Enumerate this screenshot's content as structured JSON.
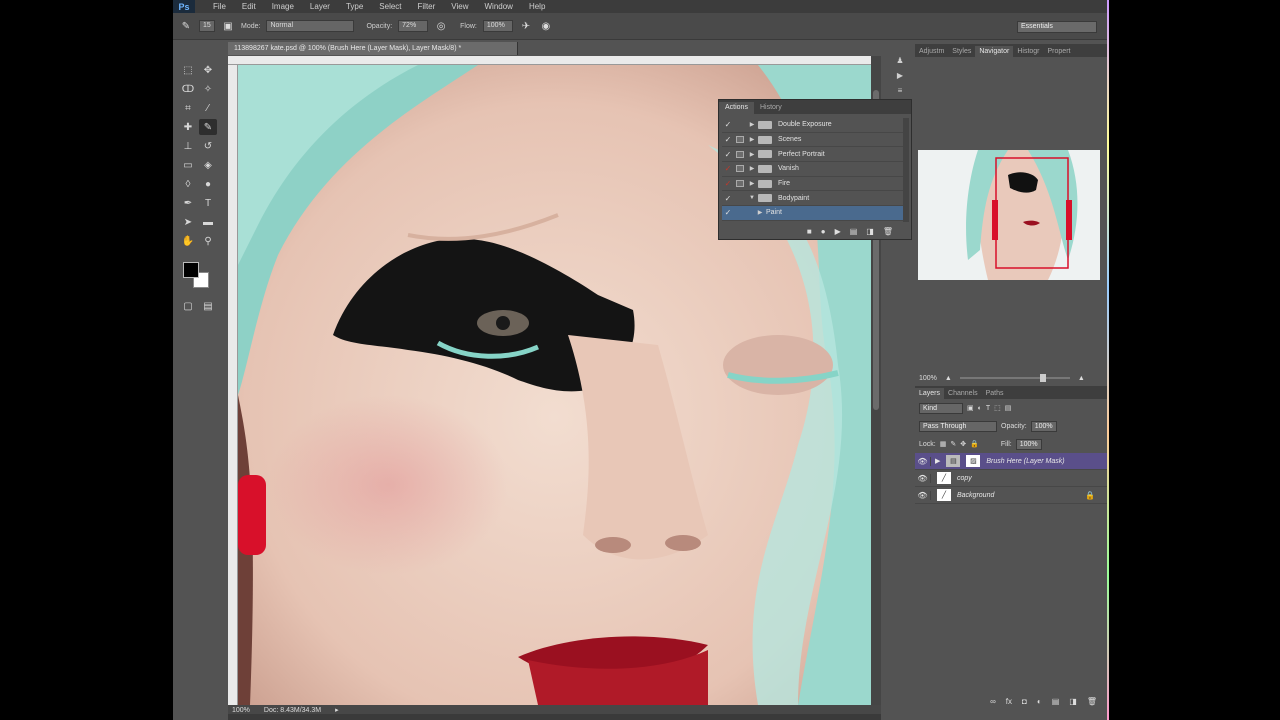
{
  "app": {
    "logo": "Ps"
  },
  "menu": [
    "File",
    "Edit",
    "Image",
    "Layer",
    "Type",
    "Select",
    "Filter",
    "View",
    "Window",
    "Help"
  ],
  "options": {
    "brush_size": "15",
    "mode_label": "Mode:",
    "mode_value": "Normal",
    "opacity_label": "Opacity:",
    "opacity_value": "72%",
    "flow_label": "Flow:",
    "flow_value": "100%",
    "workspace": "Essentials"
  },
  "document": {
    "tab_title": "113898267 kate.psd @ 100% (Brush Here (Layer Mask), Layer Mask/8) *",
    "zoom": "100%",
    "doc_size": "Doc: 8.43M/34.3M"
  },
  "actions_panel": {
    "tabs": [
      "Actions",
      "History"
    ],
    "rows": [
      {
        "name": "Double Exposure",
        "checked": true,
        "dialog": false,
        "expanded": false,
        "folder": true
      },
      {
        "name": "Scenes",
        "checked": true,
        "dialog": true,
        "expanded": false,
        "folder": true
      },
      {
        "name": "Perfect Portrait",
        "checked": true,
        "dialog": true,
        "expanded": false,
        "folder": true
      },
      {
        "name": "Vanish",
        "checked": false,
        "dialog": true,
        "expanded": false,
        "folder": true
      },
      {
        "name": "Fire",
        "checked": false,
        "dialog": true,
        "expanded": false,
        "folder": true
      },
      {
        "name": "Bodypaint",
        "checked": true,
        "dialog": false,
        "expanded": true,
        "folder": true
      },
      {
        "name": "Paint",
        "checked": true,
        "dialog": false,
        "expanded": false,
        "folder": false,
        "selected": true
      }
    ]
  },
  "right_panel": {
    "tabs": [
      "Adjustm",
      "Styles",
      "Navigator",
      "Histogr",
      "Propert"
    ],
    "nav_zoom": "100%"
  },
  "layers_panel": {
    "tabs": [
      "Layers",
      "Channels",
      "Paths"
    ],
    "kind_label": "Kind",
    "blend_mode": "Pass Through",
    "opacity_label": "Opacity:",
    "opacity_value": "100%",
    "lock_label": "Lock:",
    "fill_label": "Fill:",
    "fill_value": "100%",
    "layers": [
      {
        "name": "Brush Here (Layer Mask)",
        "selected": true,
        "locked": false
      },
      {
        "name": "copy",
        "selected": false,
        "locked": false
      },
      {
        "name": "Background",
        "selected": false,
        "locked": true
      }
    ]
  },
  "colors": {
    "accent_selection": "#5a4f8a",
    "action_selection": "#4a6a8e",
    "ui_bg": "#535353"
  }
}
